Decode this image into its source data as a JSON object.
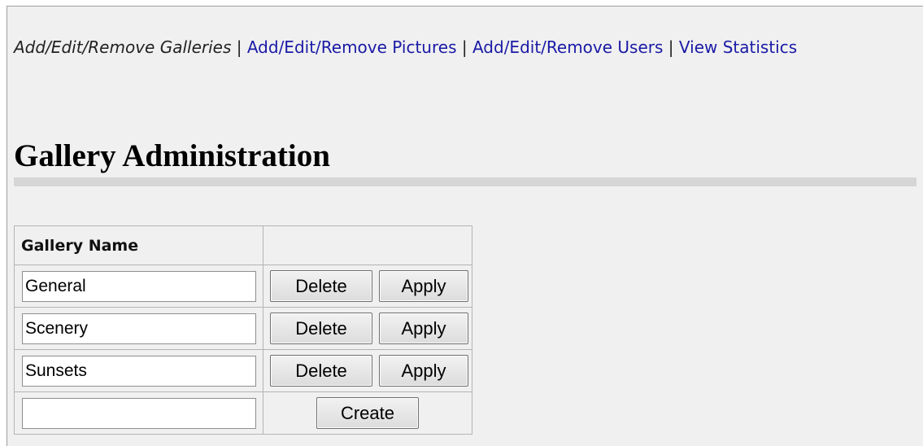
{
  "nav": {
    "items": [
      {
        "label": "Add/Edit/Remove Galleries"
      },
      {
        "label": "Add/Edit/Remove Pictures"
      },
      {
        "label": "Add/Edit/Remove Users"
      },
      {
        "label": "View Statistics"
      }
    ],
    "separator": "|"
  },
  "page": {
    "title": "Gallery Administration"
  },
  "table": {
    "headers": [
      "Gallery Name",
      ""
    ],
    "rows": [
      {
        "name": "General"
      },
      {
        "name": "Scenery"
      },
      {
        "name": "Sunsets"
      }
    ],
    "delete_label": "Delete",
    "apply_label": "Apply",
    "new_name": "",
    "create_label": "Create"
  }
}
